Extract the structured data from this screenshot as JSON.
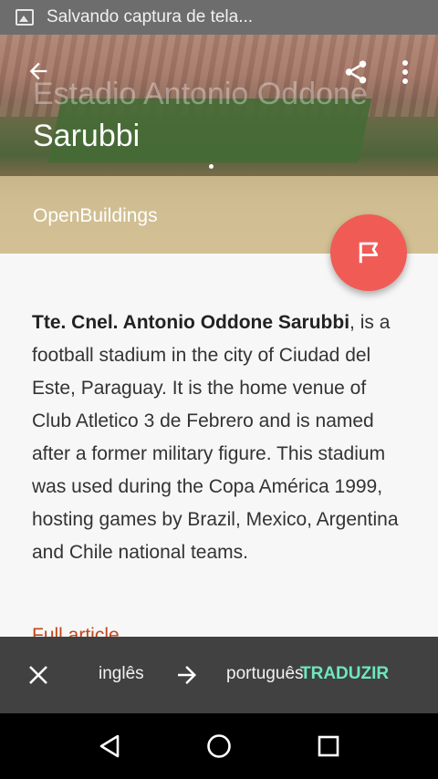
{
  "status_bar": {
    "text": "Salvando captura de tela..."
  },
  "hero": {
    "title_line1": "Estadio Antonio Oddone",
    "title_line2": "Sarubbi",
    "subtitle": "OpenBuildings"
  },
  "toolbar": {
    "back_icon": "arrow-back-icon",
    "share_icon": "share-icon",
    "more_icon": "more-vert-icon"
  },
  "fab": {
    "icon": "flag-icon"
  },
  "article": {
    "bold_name": "Tte. Cnel. Antonio Oddone Sarubbi",
    "body": ", is a football stadium in the city of Ciudad del Este, Paraguay. It is the home venue of Club Atletico 3 de Febrero and is named after a former military figure. This stadium was used during the Copa América 1999, hosting games by Brazil, Mexico, Argentina and Chile national teams.",
    "full_article": "Full article"
  },
  "translate_bar": {
    "from_language": "inglês",
    "to_language": "português",
    "action": "TRADUZIR",
    "accent_color": "#6ee6c0"
  },
  "colors": {
    "fab": "#f15b55",
    "link": "#c0461c",
    "translate_bar_bg": "#414141"
  }
}
